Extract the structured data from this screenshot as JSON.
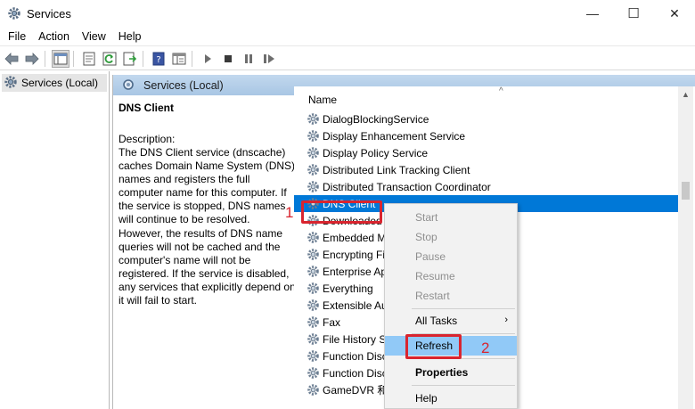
{
  "window": {
    "title": "Services",
    "icon": "gear-icon",
    "controls": [
      "minimize",
      "maximize",
      "close"
    ],
    "control_glyphs": [
      "—",
      "☐",
      "✕"
    ]
  },
  "menubar": {
    "items": [
      "File",
      "Action",
      "View",
      "Help"
    ]
  },
  "toolbar": {
    "icons": [
      "back-icon",
      "forward-icon",
      "show-console-tree-icon",
      "properties-icon",
      "refresh-icon",
      "export-list-icon",
      "help-icon",
      "extended-view-icon",
      "start-service-icon",
      "stop-service-icon",
      "pause-service-icon",
      "restart-service-icon"
    ]
  },
  "tree": {
    "selected_label": "Services (Local)"
  },
  "pane": {
    "header_label": "Services (Local)",
    "selected_service_name": "DNS Client",
    "description_heading": "Description:",
    "description_text": "The DNS Client service (dnscache) caches Domain Name System (DNS) names and registers the full computer name for this computer. If the service is stopped, DNS names will continue to be resolved. However, the results of DNS name queries will not be cached and the computer's name will not be registered. If the service is disabled, any services that explicitly depend on it will fail to start."
  },
  "list": {
    "column_name": "Name",
    "sort_indicator": "^",
    "services": [
      "DialogBlockingService",
      "Display Enhancement Service",
      "Display Policy Service",
      "Distributed Link Tracking Client",
      "Distributed Transaction Coordinator",
      "DNS Client",
      "Downloaded",
      "Embedded M",
      "Encrypting Fi",
      "Enterprise Ap",
      "Everything",
      "Extensible Au",
      "Fax",
      "File History Se",
      "Function Disc",
      "Function Disc",
      "GameDVR 和"
    ],
    "selected_index": 5
  },
  "context_menu": {
    "items": [
      {
        "label": "Start",
        "state": "disabled"
      },
      {
        "label": "Stop",
        "state": "disabled"
      },
      {
        "label": "Pause",
        "state": "disabled"
      },
      {
        "label": "Resume",
        "state": "disabled"
      },
      {
        "label": "Restart",
        "state": "disabled"
      },
      {
        "label": "All Tasks",
        "state": "submenu"
      },
      {
        "label": "Refresh",
        "state": "highlighted"
      },
      {
        "label": "Properties",
        "state": "bold"
      },
      {
        "label": "Help",
        "state": "normal"
      }
    ],
    "submenu_arrow": "›"
  },
  "annotations": {
    "step1": "1",
    "step2": "2",
    "color": "#d9252f"
  },
  "colors": {
    "selection": "#0078d7",
    "menu_highlight": "#91c9f7",
    "pane_header": "#b4cfe9"
  }
}
